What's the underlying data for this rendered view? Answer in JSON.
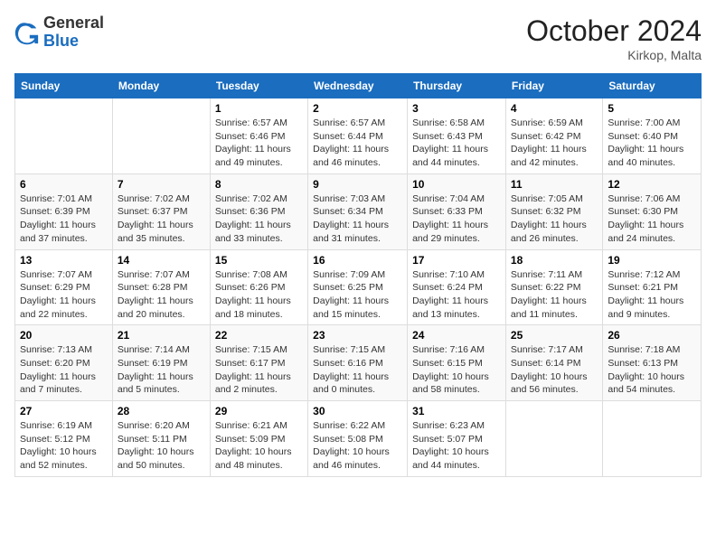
{
  "header": {
    "logo_general": "General",
    "logo_blue": "Blue",
    "month_year": "October 2024",
    "location": "Kirkop, Malta"
  },
  "weekdays": [
    "Sunday",
    "Monday",
    "Tuesday",
    "Wednesday",
    "Thursday",
    "Friday",
    "Saturday"
  ],
  "weeks": [
    [
      {
        "day": "",
        "info": ""
      },
      {
        "day": "",
        "info": ""
      },
      {
        "day": "1",
        "info": "Sunrise: 6:57 AM\nSunset: 6:46 PM\nDaylight: 11 hours and 49 minutes."
      },
      {
        "day": "2",
        "info": "Sunrise: 6:57 AM\nSunset: 6:44 PM\nDaylight: 11 hours and 46 minutes."
      },
      {
        "day": "3",
        "info": "Sunrise: 6:58 AM\nSunset: 6:43 PM\nDaylight: 11 hours and 44 minutes."
      },
      {
        "day": "4",
        "info": "Sunrise: 6:59 AM\nSunset: 6:42 PM\nDaylight: 11 hours and 42 minutes."
      },
      {
        "day": "5",
        "info": "Sunrise: 7:00 AM\nSunset: 6:40 PM\nDaylight: 11 hours and 40 minutes."
      }
    ],
    [
      {
        "day": "6",
        "info": "Sunrise: 7:01 AM\nSunset: 6:39 PM\nDaylight: 11 hours and 37 minutes."
      },
      {
        "day": "7",
        "info": "Sunrise: 7:02 AM\nSunset: 6:37 PM\nDaylight: 11 hours and 35 minutes."
      },
      {
        "day": "8",
        "info": "Sunrise: 7:02 AM\nSunset: 6:36 PM\nDaylight: 11 hours and 33 minutes."
      },
      {
        "day": "9",
        "info": "Sunrise: 7:03 AM\nSunset: 6:34 PM\nDaylight: 11 hours and 31 minutes."
      },
      {
        "day": "10",
        "info": "Sunrise: 7:04 AM\nSunset: 6:33 PM\nDaylight: 11 hours and 29 minutes."
      },
      {
        "day": "11",
        "info": "Sunrise: 7:05 AM\nSunset: 6:32 PM\nDaylight: 11 hours and 26 minutes."
      },
      {
        "day": "12",
        "info": "Sunrise: 7:06 AM\nSunset: 6:30 PM\nDaylight: 11 hours and 24 minutes."
      }
    ],
    [
      {
        "day": "13",
        "info": "Sunrise: 7:07 AM\nSunset: 6:29 PM\nDaylight: 11 hours and 22 minutes."
      },
      {
        "day": "14",
        "info": "Sunrise: 7:07 AM\nSunset: 6:28 PM\nDaylight: 11 hours and 20 minutes."
      },
      {
        "day": "15",
        "info": "Sunrise: 7:08 AM\nSunset: 6:26 PM\nDaylight: 11 hours and 18 minutes."
      },
      {
        "day": "16",
        "info": "Sunrise: 7:09 AM\nSunset: 6:25 PM\nDaylight: 11 hours and 15 minutes."
      },
      {
        "day": "17",
        "info": "Sunrise: 7:10 AM\nSunset: 6:24 PM\nDaylight: 11 hours and 13 minutes."
      },
      {
        "day": "18",
        "info": "Sunrise: 7:11 AM\nSunset: 6:22 PM\nDaylight: 11 hours and 11 minutes."
      },
      {
        "day": "19",
        "info": "Sunrise: 7:12 AM\nSunset: 6:21 PM\nDaylight: 11 hours and 9 minutes."
      }
    ],
    [
      {
        "day": "20",
        "info": "Sunrise: 7:13 AM\nSunset: 6:20 PM\nDaylight: 11 hours and 7 minutes."
      },
      {
        "day": "21",
        "info": "Sunrise: 7:14 AM\nSunset: 6:19 PM\nDaylight: 11 hours and 5 minutes."
      },
      {
        "day": "22",
        "info": "Sunrise: 7:15 AM\nSunset: 6:17 PM\nDaylight: 11 hours and 2 minutes."
      },
      {
        "day": "23",
        "info": "Sunrise: 7:15 AM\nSunset: 6:16 PM\nDaylight: 11 hours and 0 minutes."
      },
      {
        "day": "24",
        "info": "Sunrise: 7:16 AM\nSunset: 6:15 PM\nDaylight: 10 hours and 58 minutes."
      },
      {
        "day": "25",
        "info": "Sunrise: 7:17 AM\nSunset: 6:14 PM\nDaylight: 10 hours and 56 minutes."
      },
      {
        "day": "26",
        "info": "Sunrise: 7:18 AM\nSunset: 6:13 PM\nDaylight: 10 hours and 54 minutes."
      }
    ],
    [
      {
        "day": "27",
        "info": "Sunrise: 6:19 AM\nSunset: 5:12 PM\nDaylight: 10 hours and 52 minutes."
      },
      {
        "day": "28",
        "info": "Sunrise: 6:20 AM\nSunset: 5:11 PM\nDaylight: 10 hours and 50 minutes."
      },
      {
        "day": "29",
        "info": "Sunrise: 6:21 AM\nSunset: 5:09 PM\nDaylight: 10 hours and 48 minutes."
      },
      {
        "day": "30",
        "info": "Sunrise: 6:22 AM\nSunset: 5:08 PM\nDaylight: 10 hours and 46 minutes."
      },
      {
        "day": "31",
        "info": "Sunrise: 6:23 AM\nSunset: 5:07 PM\nDaylight: 10 hours and 44 minutes."
      },
      {
        "day": "",
        "info": ""
      },
      {
        "day": "",
        "info": ""
      }
    ]
  ]
}
